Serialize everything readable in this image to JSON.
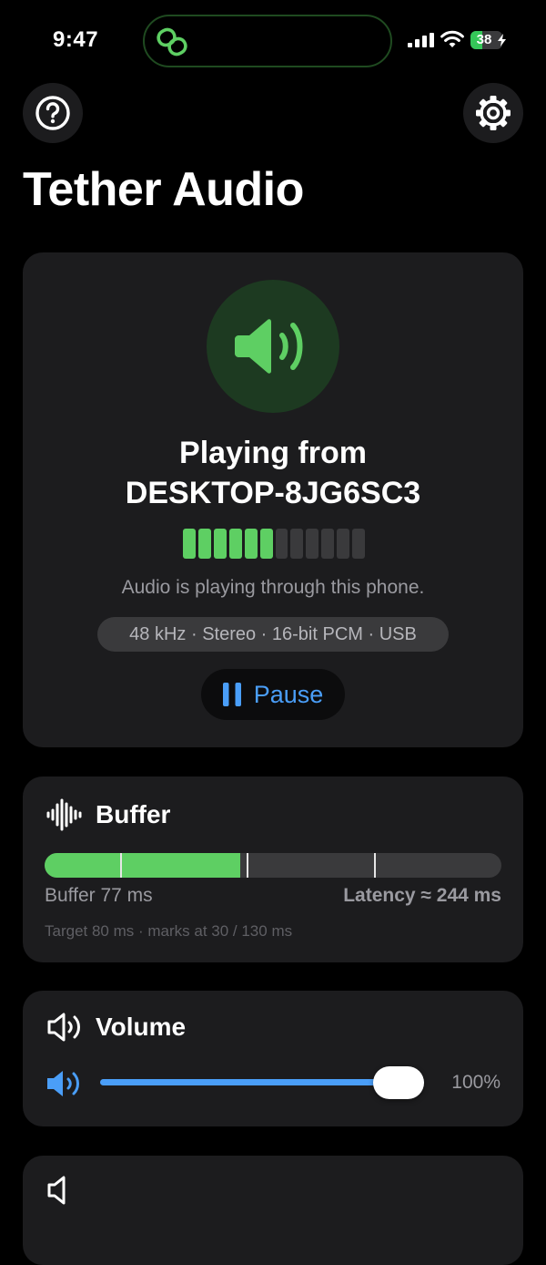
{
  "status_bar": {
    "time": "9:47",
    "battery_percent": 38,
    "battery_label": "38",
    "island_icon": "link-icon",
    "accent_color": "#35c759"
  },
  "header": {
    "title": "Tether Audio",
    "help_icon": "question-circle-icon",
    "settings_icon": "gear-icon"
  },
  "now_playing": {
    "title_line1": "Playing from",
    "title_line2": "DESKTOP-8JG6SC3",
    "level_segments_total": 12,
    "level_segments_active": 6,
    "status_text": "Audio is playing through this phone.",
    "format": "48 kHz · Stereo · 16-bit PCM · USB",
    "pause_label": "Pause",
    "accent_color": "#5ecf63"
  },
  "buffer": {
    "title": "Buffer",
    "icon": "waveform-icon",
    "buffer_text": "Buffer 77 ms",
    "latency_text": "Latency ≈ 244 ms",
    "note": "Target 80 ms · marks at 30 / 130 ms",
    "buffer_ms": 77,
    "scale_max_ms": 180,
    "marks_ms": [
      30,
      80,
      130
    ]
  },
  "volume": {
    "title": "Volume",
    "icon": "speaker-outline-icon",
    "value_text": "100%",
    "level": 1.0,
    "accent_color": "#4a9ef8"
  }
}
